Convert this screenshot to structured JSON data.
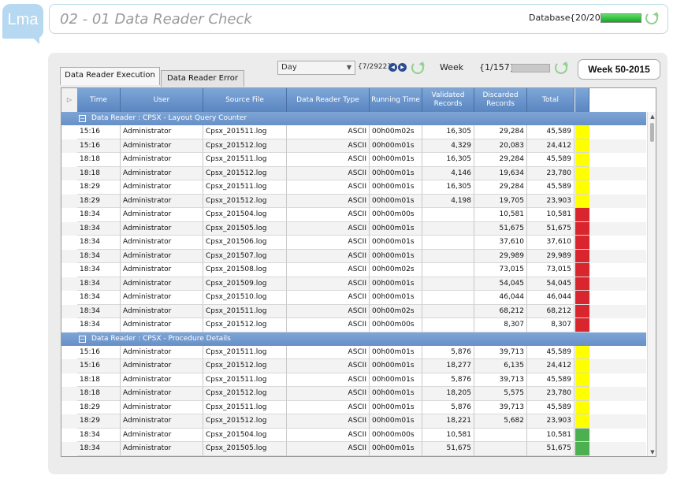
{
  "app": {
    "logo_text": "Lma",
    "page_title": "02 - 01 Data Reader Check"
  },
  "database": {
    "label": "Database",
    "count": "{20/20}",
    "progress": 1.0
  },
  "tabs": [
    {
      "label": "Data Reader Execution",
      "active": true
    },
    {
      "label": "Data Reader Error",
      "active": false
    }
  ],
  "toolbar": {
    "period_value": "Day",
    "page_indicator": "{7/2922}",
    "week_label": "Week",
    "week_count": "{1/157}",
    "week_progress": 0,
    "week_button": "Week 50-2015"
  },
  "columns": [
    "Time",
    "User",
    "Source File",
    "Data Reader Type",
    "Running Time",
    "Validated Records",
    "Discarded Records",
    "Total"
  ],
  "colors": {
    "yellow": "#ffff00",
    "red": "#d9252e",
    "green": "#4caf50",
    "accent": "#5a85c0"
  },
  "groups": [
    {
      "title": "Data Reader : CPSX - Layout Query Counter",
      "rows": [
        {
          "time": "15:16",
          "user": "Administrator",
          "file": "Cpsx_201511.log",
          "type": "ASCII",
          "running": "00h00m02s",
          "validated": "16,305",
          "discarded": "29,284",
          "total": "45,589",
          "status": "yellow"
        },
        {
          "time": "15:16",
          "user": "Administrator",
          "file": "Cpsx_201512.log",
          "type": "ASCII",
          "running": "00h00m01s",
          "validated": "4,329",
          "discarded": "20,083",
          "total": "24,412",
          "status": "yellow"
        },
        {
          "time": "18:18",
          "user": "Administrator",
          "file": "Cpsx_201511.log",
          "type": "ASCII",
          "running": "00h00m01s",
          "validated": "16,305",
          "discarded": "29,284",
          "total": "45,589",
          "status": "yellow"
        },
        {
          "time": "18:18",
          "user": "Administrator",
          "file": "Cpsx_201512.log",
          "type": "ASCII",
          "running": "00h00m01s",
          "validated": "4,146",
          "discarded": "19,634",
          "total": "23,780",
          "status": "yellow"
        },
        {
          "time": "18:29",
          "user": "Administrator",
          "file": "Cpsx_201511.log",
          "type": "ASCII",
          "running": "00h00m01s",
          "validated": "16,305",
          "discarded": "29,284",
          "total": "45,589",
          "status": "yellow"
        },
        {
          "time": "18:29",
          "user": "Administrator",
          "file": "Cpsx_201512.log",
          "type": "ASCII",
          "running": "00h00m01s",
          "validated": "4,198",
          "discarded": "19,705",
          "total": "23,903",
          "status": "yellow"
        },
        {
          "time": "18:34",
          "user": "Administrator",
          "file": "Cpsx_201504.log",
          "type": "ASCII",
          "running": "00h00m00s",
          "validated": "",
          "discarded": "10,581",
          "total": "10,581",
          "status": "red"
        },
        {
          "time": "18:34",
          "user": "Administrator",
          "file": "Cpsx_201505.log",
          "type": "ASCII",
          "running": "00h00m01s",
          "validated": "",
          "discarded": "51,675",
          "total": "51,675",
          "status": "red"
        },
        {
          "time": "18:34",
          "user": "Administrator",
          "file": "Cpsx_201506.log",
          "type": "ASCII",
          "running": "00h00m01s",
          "validated": "",
          "discarded": "37,610",
          "total": "37,610",
          "status": "red"
        },
        {
          "time": "18:34",
          "user": "Administrator",
          "file": "Cpsx_201507.log",
          "type": "ASCII",
          "running": "00h00m01s",
          "validated": "",
          "discarded": "29,989",
          "total": "29,989",
          "status": "red"
        },
        {
          "time": "18:34",
          "user": "Administrator",
          "file": "Cpsx_201508.log",
          "type": "ASCII",
          "running": "00h00m02s",
          "validated": "",
          "discarded": "73,015",
          "total": "73,015",
          "status": "red"
        },
        {
          "time": "18:34",
          "user": "Administrator",
          "file": "Cpsx_201509.log",
          "type": "ASCII",
          "running": "00h00m01s",
          "validated": "",
          "discarded": "54,045",
          "total": "54,045",
          "status": "red"
        },
        {
          "time": "18:34",
          "user": "Administrator",
          "file": "Cpsx_201510.log",
          "type": "ASCII",
          "running": "00h00m01s",
          "validated": "",
          "discarded": "46,044",
          "total": "46,044",
          "status": "red"
        },
        {
          "time": "18:34",
          "user": "Administrator",
          "file": "Cpsx_201511.log",
          "type": "ASCII",
          "running": "00h00m02s",
          "validated": "",
          "discarded": "68,212",
          "total": "68,212",
          "status": "red"
        },
        {
          "time": "18:34",
          "user": "Administrator",
          "file": "Cpsx_201512.log",
          "type": "ASCII",
          "running": "00h00m00s",
          "validated": "",
          "discarded": "8,307",
          "total": "8,307",
          "status": "red"
        }
      ]
    },
    {
      "title": "Data Reader : CPSX - Procedure Details",
      "rows": [
        {
          "time": "15:16",
          "user": "Administrator",
          "file": "Cpsx_201511.log",
          "type": "ASCII",
          "running": "00h00m01s",
          "validated": "5,876",
          "discarded": "39,713",
          "total": "45,589",
          "status": "yellow"
        },
        {
          "time": "15:16",
          "user": "Administrator",
          "file": "Cpsx_201512.log",
          "type": "ASCII",
          "running": "00h00m01s",
          "validated": "18,277",
          "discarded": "6,135",
          "total": "24,412",
          "status": "yellow"
        },
        {
          "time": "18:18",
          "user": "Administrator",
          "file": "Cpsx_201511.log",
          "type": "ASCII",
          "running": "00h00m01s",
          "validated": "5,876",
          "discarded": "39,713",
          "total": "45,589",
          "status": "yellow"
        },
        {
          "time": "18:18",
          "user": "Administrator",
          "file": "Cpsx_201512.log",
          "type": "ASCII",
          "running": "00h00m01s",
          "validated": "18,205",
          "discarded": "5,575",
          "total": "23,780",
          "status": "yellow"
        },
        {
          "time": "18:29",
          "user": "Administrator",
          "file": "Cpsx_201511.log",
          "type": "ASCII",
          "running": "00h00m01s",
          "validated": "5,876",
          "discarded": "39,713",
          "total": "45,589",
          "status": "yellow"
        },
        {
          "time": "18:29",
          "user": "Administrator",
          "file": "Cpsx_201512.log",
          "type": "ASCII",
          "running": "00h00m01s",
          "validated": "18,221",
          "discarded": "5,682",
          "total": "23,903",
          "status": "yellow"
        },
        {
          "time": "18:34",
          "user": "Administrator",
          "file": "Cpsx_201504.log",
          "type": "ASCII",
          "running": "00h00m00s",
          "validated": "10,581",
          "discarded": "",
          "total": "10,581",
          "status": "green"
        },
        {
          "time": "18:34",
          "user": "Administrator",
          "file": "Cpsx_201505.log",
          "type": "ASCII",
          "running": "00h00m01s",
          "validated": "51,675",
          "discarded": "",
          "total": "51,675",
          "status": "green"
        }
      ]
    }
  ]
}
